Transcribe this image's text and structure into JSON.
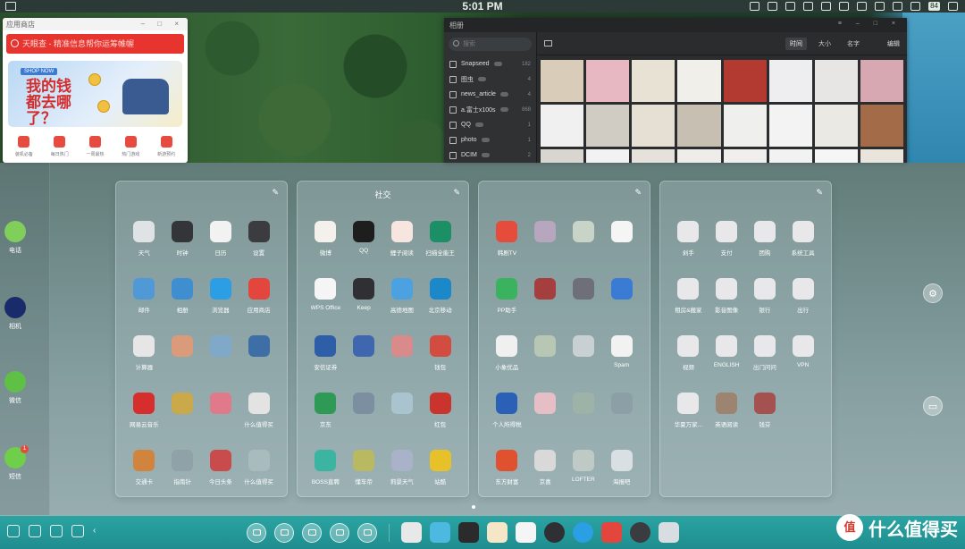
{
  "status_bar": {
    "time": "5:01 PM",
    "battery": "84"
  },
  "app_store_window": {
    "title": "应用商店",
    "search_placeholder": "天眼查 - 精准信息帮你运筹帷幄",
    "banner_tag": "SHOP NOW",
    "banner_text": "我的钱都去哪了？",
    "categories": [
      "装机必备",
      "每日热门",
      "一周最热",
      "热门游戏",
      "新游预约"
    ]
  },
  "gallery_window": {
    "title": "相册",
    "search_placeholder": "搜索",
    "albums": [
      {
        "name": "Snapseed",
        "count": "182"
      },
      {
        "name": "图虫",
        "count": "4"
      },
      {
        "name": "news_article",
        "count": "4"
      },
      {
        "name": "a.富士x100s",
        "count": "868"
      },
      {
        "name": "QQ",
        "count": "1"
      },
      {
        "name": "photo",
        "count": "1"
      },
      {
        "name": "DCIM",
        "count": "2"
      }
    ],
    "sort_options": [
      "时间",
      "大小",
      "名字"
    ],
    "edit_label": "编辑"
  },
  "left_dock": [
    {
      "label": "电话",
      "color": "#7fcf5a",
      "badge": ""
    },
    {
      "label": "相机",
      "color": "#1a2b6b",
      "badge": ""
    },
    {
      "label": "微信",
      "color": "#5fc046",
      "badge": ""
    },
    {
      "label": "短信",
      "color": "#6fcf4a",
      "badge": "1"
    }
  ],
  "folders": [
    {
      "title": "",
      "apps": [
        {
          "label": "天气",
          "color": "#dfe3e6"
        },
        {
          "label": "时钟",
          "color": "#333539"
        },
        {
          "label": "日历",
          "color": "#f2f2f2"
        },
        {
          "label": "设置",
          "color": "#3a3c40"
        },
        {
          "label": "邮件",
          "color": "#4f9ad6"
        },
        {
          "label": "相册",
          "color": "#3f8fd0"
        },
        {
          "label": "浏览器",
          "color": "#2c9ee4"
        },
        {
          "label": "应用商店",
          "color": "#e2463c"
        },
        {
          "label": "计算器",
          "color": "#e6e6e6"
        },
        {
          "label": "",
          "color": "#d99b7a"
        },
        {
          "label": "",
          "color": "#7fa8c9"
        },
        {
          "label": "",
          "color": "#3d6ea6"
        },
        {
          "label": "网易云音乐",
          "color": "#d62d2d"
        },
        {
          "label": "",
          "color": "#c9a94a"
        },
        {
          "label": "",
          "color": "#e07a8a"
        },
        {
          "label": "什么值得买",
          "color": "#e3e3e3"
        },
        {
          "label": "交通卡",
          "color": "#d1843d"
        },
        {
          "label": "指南针",
          "color": "#8fa2a8"
        },
        {
          "label": "今日头条",
          "color": "#c94b4b"
        },
        {
          "label": "什么值得买",
          "color": "#a9bcbd"
        }
      ]
    },
    {
      "title": "社交",
      "apps": [
        {
          "label": "微博",
          "color": "#f4f1ec"
        },
        {
          "label": "QQ",
          "color": "#1e1e1e"
        },
        {
          "label": "鲤子阅读",
          "color": "#f6e6df"
        },
        {
          "label": "扫描全能王",
          "color": "#1c8f66"
        },
        {
          "label": "WPS Office",
          "color": "#f5f5f5"
        },
        {
          "label": "Keep",
          "color": "#2f2f34"
        },
        {
          "label": "高德地图",
          "color": "#4ca1e0"
        },
        {
          "label": "北京移动",
          "color": "#1a88c9"
        },
        {
          "label": "安信证券",
          "color": "#2e5ea8"
        },
        {
          "label": "",
          "color": "#3f67b0"
        },
        {
          "label": "",
          "color": "#d98a8a"
        },
        {
          "label": "钱包",
          "color": "#d24c3f"
        },
        {
          "label": "京东",
          "color": "#2f9a55"
        },
        {
          "label": "",
          "color": "#7b8fa0"
        },
        {
          "label": "",
          "color": "#a9c4cf"
        },
        {
          "label": "红包",
          "color": "#c9342d"
        },
        {
          "label": "BOSS直聘",
          "color": "#3bb5a2"
        },
        {
          "label": "懂车帝",
          "color": "#b9b962"
        },
        {
          "label": "莉景天气",
          "color": "#a9b2c8"
        },
        {
          "label": "站酷",
          "color": "#e6c12a"
        }
      ]
    },
    {
      "title": "",
      "apps": [
        {
          "label": "韩剧TV",
          "color": "#e64c3c"
        },
        {
          "label": "",
          "color": "#b6a7bf"
        },
        {
          "label": "",
          "color": "#c7d4c7"
        },
        {
          "label": "",
          "color": "#f5f5f5"
        },
        {
          "label": "PP助手",
          "color": "#3bb35e"
        },
        {
          "label": "",
          "color": "#a53e3e"
        },
        {
          "label": "",
          "color": "#6f6f7a"
        },
        {
          "label": "",
          "color": "#3a7bd4"
        },
        {
          "label": "小象优品",
          "color": "#f0f0f0"
        },
        {
          "label": "",
          "color": "#b8c7b4"
        },
        {
          "label": "",
          "color": "#c9d0d3"
        },
        {
          "label": "Spam",
          "color": "#f2f2f2"
        },
        {
          "label": "个人所得税",
          "color": "#2a61b7"
        },
        {
          "label": "",
          "color": "#e5bfc5"
        },
        {
          "label": "",
          "color": "#9db3a8"
        },
        {
          "label": "",
          "color": "#8c9fa6"
        },
        {
          "label": "东方财富",
          "color": "#e0522f"
        },
        {
          "label": "京喜",
          "color": "#d9d9d9"
        },
        {
          "label": "LOFTER",
          "color": "#bfcac6"
        },
        {
          "label": "海报吧",
          "color": "#d8e0e4"
        }
      ]
    },
    {
      "title": "",
      "apps": [
        {
          "label": "剁手",
          "color": "#e8e8ea"
        },
        {
          "label": "支付",
          "color": "#e8e8ea"
        },
        {
          "label": "团购",
          "color": "#e8e8ea"
        },
        {
          "label": "系统工具",
          "color": "#e8e8ea"
        },
        {
          "label": "租房&搬家",
          "color": "#e8e8ea"
        },
        {
          "label": "影音图像",
          "color": "#e8e8ea"
        },
        {
          "label": "银行",
          "color": "#e8e8ea"
        },
        {
          "label": "出行",
          "color": "#e8e8ea"
        },
        {
          "label": "视频",
          "color": "#e8e8ea"
        },
        {
          "label": "ENGLISH",
          "color": "#e8e8ea"
        },
        {
          "label": "出门问问",
          "color": "#e8e8ea"
        },
        {
          "label": "VPN",
          "color": "#e8e8ea"
        },
        {
          "label": "华夏万家...",
          "color": "#e8e8ea"
        },
        {
          "label": "英语阅读",
          "color": "#9c8470"
        },
        {
          "label": "钱芬",
          "color": "#a5514f"
        }
      ]
    }
  ],
  "taskbar": {
    "tray_apps": [
      {
        "name": "launcher",
        "color": "#e8e8e8"
      },
      {
        "name": "gallery",
        "color": "#4db8e0"
      },
      {
        "name": "music",
        "color": "#2b2b2b"
      },
      {
        "name": "notes",
        "color": "#f5e6c8"
      },
      {
        "name": "calendar",
        "color": "#f5f5f5"
      },
      {
        "name": "clock",
        "color": "#2f3033"
      },
      {
        "name": "browser",
        "color": "#2a9fe3"
      },
      {
        "name": "app-store",
        "color": "#e2463c"
      },
      {
        "name": "settings",
        "color": "#3a3c40"
      },
      {
        "name": "trash",
        "color": "#d7dde0"
      }
    ],
    "watermark": "什么值得买",
    "watermark_logo": "值"
  }
}
